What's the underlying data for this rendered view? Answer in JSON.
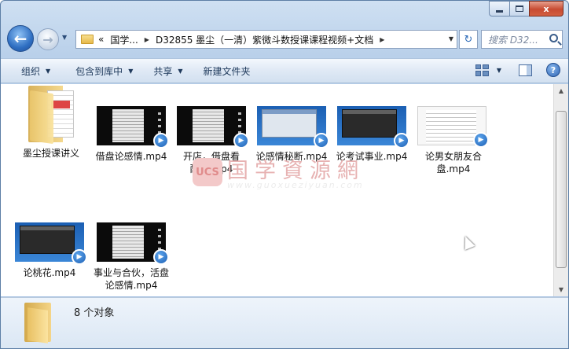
{
  "window": {
    "controls": {
      "minimize": "",
      "maximize": "",
      "close": "x"
    }
  },
  "address_bar": {
    "overflow": "«",
    "segments": [
      "国学...",
      "D32855 墨尘（一清）紫微斗数授课课程视频+文档"
    ],
    "separator": "▶",
    "search_placeholder": "搜索 D32..."
  },
  "toolbar": {
    "organize": "组织",
    "include_library": "包含到库中",
    "share": "共享",
    "new_folder": "新建文件夹"
  },
  "files": [
    {
      "name": "墨尘授课讲义",
      "type": "folder"
    },
    {
      "name": "借盘论感情.mp4",
      "type": "video",
      "thumb": "dark"
    },
    {
      "name": "开店，借盘看配偶.mp4",
      "type": "video",
      "thumb": "dark"
    },
    {
      "name": "论感情秘断.mp4",
      "type": "video",
      "thumb": "desk"
    },
    {
      "name": "论考试事业.mp4",
      "type": "video",
      "thumb": "blackdesk"
    },
    {
      "name": "论男女朋友合盘.mp4",
      "type": "video",
      "thumb": "white"
    },
    {
      "name": "论桃花.mp4",
      "type": "video",
      "thumb": "blackdesk"
    },
    {
      "name": "事业与合伙，活盘论感情.mp4",
      "type": "video",
      "thumb": "dark"
    }
  ],
  "watermark": {
    "badge": "UCS",
    "title": "国学資源網",
    "url": "www.guoxueziyuan.com"
  },
  "status": {
    "item_count": "8 个对象"
  },
  "colors": {
    "accent": "#2d63b3",
    "close_button": "#c74b32",
    "toolbar_bg": "#dfe9f5"
  }
}
